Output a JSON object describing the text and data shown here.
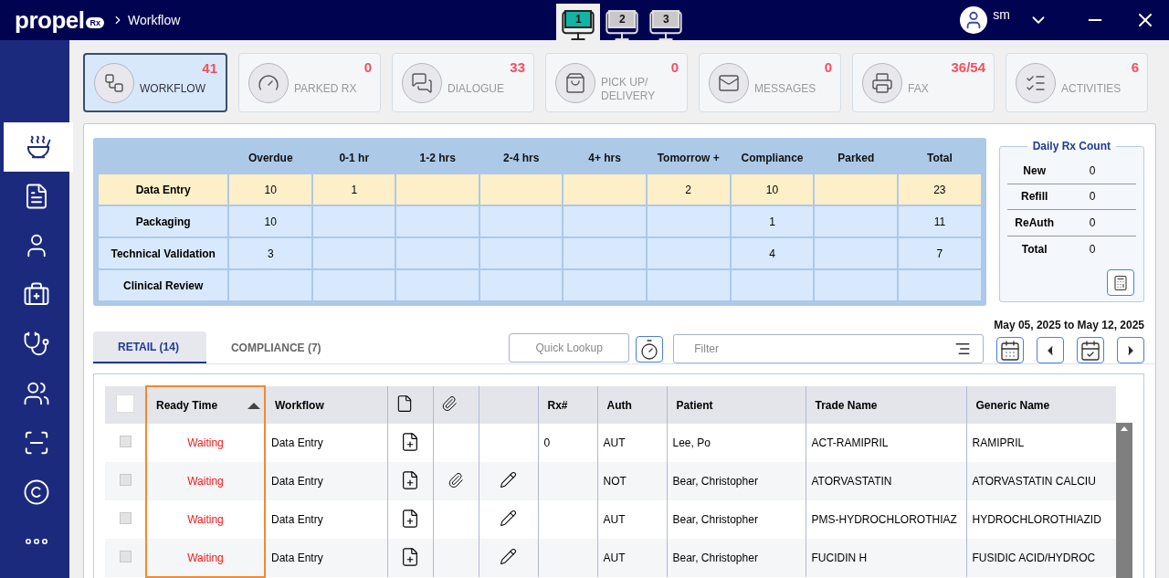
{
  "header": {
    "logo": "propel",
    "logo_badge": "Rx",
    "breadcrumb": "Workflow",
    "monitors": [
      {
        "label": "1",
        "selected": true
      },
      {
        "label": "2",
        "selected": false
      },
      {
        "label": "3",
        "selected": false
      }
    ],
    "user": "sm"
  },
  "sidebar": {
    "items": [
      {
        "kind": "mortar",
        "selected": true
      },
      {
        "kind": "rx",
        "selected": false
      },
      {
        "kind": "person",
        "selected": false
      },
      {
        "kind": "bottle",
        "selected": false
      },
      {
        "kind": "stethoscope",
        "selected": false
      },
      {
        "kind": "group",
        "selected": false
      },
      {
        "kind": "scanner",
        "selected": false
      },
      {
        "kind": "pc",
        "selected": false
      },
      {
        "kind": "more",
        "selected": false
      }
    ]
  },
  "tiles": [
    {
      "kind": "workflow",
      "label": "WORKFLOW",
      "count": "41",
      "selected": true
    },
    {
      "kind": "parked",
      "label": "PARKED RX",
      "count": "0",
      "selected": false
    },
    {
      "kind": "dialogue",
      "label": "DIALOGUE",
      "count": "33",
      "selected": false
    },
    {
      "kind": "pickup",
      "label": "PICK UP/ DELIVERY",
      "count": "0",
      "selected": false
    },
    {
      "kind": "messages",
      "label": "MESSAGES",
      "count": "0",
      "selected": false
    },
    {
      "kind": "fax",
      "label": "FAX",
      "count": "36/54",
      "selected": false
    },
    {
      "kind": "activities",
      "label": "ACTIVITIES",
      "count": "6",
      "selected": false
    }
  ],
  "summary": {
    "columns": [
      "Overdue",
      "0-1 hr",
      "1-2 hrs",
      "2-4 hrs",
      "4+ hrs",
      "Tomorrow +",
      "Compliance",
      "Parked",
      "Total"
    ],
    "rows": [
      {
        "label": "Data Entry",
        "selected": true,
        "cells": [
          "10",
          "1",
          "",
          "",
          "",
          "2",
          "10",
          "",
          "23"
        ]
      },
      {
        "label": "Packaging",
        "selected": false,
        "cells": [
          "10",
          "",
          "",
          "",
          "",
          "",
          "1",
          "",
          "11"
        ]
      },
      {
        "label": "Technical Validation",
        "selected": false,
        "cells": [
          "3",
          "",
          "",
          "",
          "",
          "",
          "4",
          "",
          "7"
        ]
      },
      {
        "label": "Clinical Review",
        "selected": false,
        "cells": [
          "",
          "",
          "",
          "",
          "",
          "",
          "",
          "",
          ""
        ]
      }
    ]
  },
  "daily_rx_count": {
    "title": "Daily Rx Count",
    "rows": [
      {
        "label": "New",
        "value": "0"
      },
      {
        "label": "Refill",
        "value": "0"
      },
      {
        "label": "ReAuth",
        "value": "0"
      },
      {
        "label": "Total",
        "value": "0"
      }
    ]
  },
  "toolbar": {
    "quick_lookup": "Quick Lookup",
    "filter_placeholder": "Filter",
    "date_range": "May 05, 2025 to May 12, 2025"
  },
  "tabs": [
    {
      "label": "RETAIL (14)",
      "selected": true
    },
    {
      "label": "COMPLIANCE (7)",
      "selected": false
    }
  ],
  "table": {
    "all_checked": false,
    "columns": [
      {
        "kind": "check"
      },
      {
        "kind": "text",
        "label": "Ready Time",
        "sort_ascending": true,
        "highlighted": true
      },
      {
        "kind": "text",
        "label": "Workflow"
      },
      {
        "kind": "doc"
      },
      {
        "kind": "clip"
      },
      {
        "kind": "edit"
      },
      {
        "kind": "text",
        "label": "Rx#"
      },
      {
        "kind": "text",
        "label": "Auth"
      },
      {
        "kind": "text",
        "label": "Patient"
      },
      {
        "kind": "text",
        "label": "Trade Name"
      },
      {
        "kind": "text",
        "label": "Generic Name"
      }
    ],
    "rows": [
      {
        "checked": false,
        "ready_time": "Waiting",
        "workflow": "Data Entry",
        "attachment": false,
        "editable": false,
        "rx": "0",
        "auth": "AUT",
        "patient": "Lee, Po",
        "trade_name": "ACT-RAMIPRIL",
        "generic_name": "RAMIPRIL"
      },
      {
        "checked": false,
        "ready_time": "Waiting",
        "workflow": "Data Entry",
        "attachment": true,
        "editable": true,
        "rx": "",
        "auth": "NOT",
        "patient": "Bear, Christopher",
        "trade_name": "ATORVASTATIN",
        "generic_name": "ATORVASTATIN CALCIU"
      },
      {
        "checked": false,
        "ready_time": "Waiting",
        "workflow": "Data Entry",
        "attachment": false,
        "editable": true,
        "rx": "",
        "auth": "AUT",
        "patient": "Bear, Christopher",
        "trade_name": "PMS-HYDROCHLOROTHIAZ",
        "generic_name": "HYDROCHLOROTHIAZID"
      },
      {
        "checked": false,
        "ready_time": "Waiting",
        "workflow": "Data Entry",
        "attachment": false,
        "editable": true,
        "rx": "",
        "auth": "AUT",
        "patient": "Bear, Christopher",
        "trade_name": "FUCIDIN H",
        "generic_name": "FUSIDIC ACID/HYDROC"
      }
    ]
  }
}
